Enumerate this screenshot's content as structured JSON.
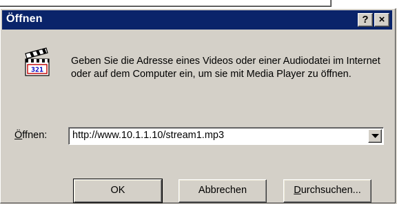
{
  "dialog": {
    "title": "Öffnen",
    "help_button": "?",
    "close_button": "×",
    "message": "Geben Sie die Adresse eines Videos oder einer Audiodatei im Internet oder auf dem Computer ein, um sie mit Media Player zu öffnen.",
    "icon": "clapperboard-321-icon",
    "open_label_accel": "Ö",
    "open_label_rest": "ffnen:",
    "open_value": "http://www.10.1.1.10/stream1.mp3",
    "buttons": {
      "ok": "OK",
      "cancel": "Abbrechen",
      "browse_accel": "D",
      "browse_rest": "urchsuchen..."
    }
  },
  "colors": {
    "titlebar": "#0a246a",
    "face": "#d4d0c8"
  }
}
